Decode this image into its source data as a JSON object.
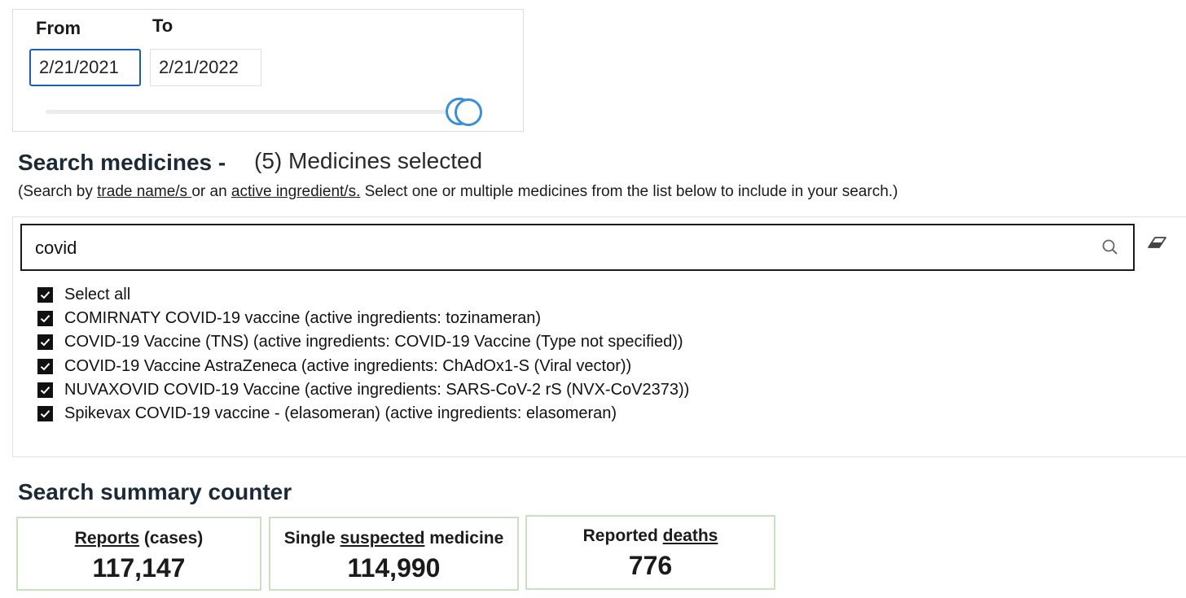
{
  "date_range": {
    "from_label": "From",
    "to_label": "To",
    "from_value": "2/21/2021",
    "to_value": "2/21/2022",
    "slider_position": 1.0
  },
  "search": {
    "title": "Search medicines -",
    "selected_count_text": "(5) Medicines selected",
    "help": {
      "prefix": "(Search by ",
      "trade_name_link": "trade name/s ",
      "middle": "or an ",
      "ingredient_link": "active ingredient/s.",
      "suffix": " Select one or multiple medicines from the list below to include in your search.)"
    },
    "query": "covid",
    "options": [
      {
        "label": "Select all",
        "checked": true
      },
      {
        "label": "COMIRNATY COVID-19 vaccine (active ingredients: tozinameran)",
        "checked": true
      },
      {
        "label": "COVID-19 Vaccine (TNS) (active ingredients: COVID-19 Vaccine (Type not specified))",
        "checked": true
      },
      {
        "label": "COVID-19 Vaccine AstraZeneca (active ingredients: ChAdOx1-S (Viral vector))",
        "checked": true
      },
      {
        "label": "NUVAXOVID COVID-19 Vaccine (active ingredients: SARS-CoV-2 rS (NVX-CoV2373))",
        "checked": true
      },
      {
        "label": "Spikevax COVID-19 vaccine - (elasomeran) (active ingredients: elasomeran)",
        "checked": true
      }
    ]
  },
  "summary": {
    "title": "Search summary counter",
    "reports": {
      "label_link": "Reports",
      "label_rest": " (cases)",
      "value": "117,147"
    },
    "single": {
      "label_pre": "Single ",
      "label_link": "suspected",
      "label_post": " medicine",
      "value": "114,990"
    },
    "deaths": {
      "label_pre": "Reported ",
      "label_link": "deaths",
      "value": "776"
    }
  },
  "colors": {
    "focus_border": "#1a5fb4",
    "slider_knob": "#3a8fd6",
    "card_border": "#c8e2c0",
    "heading": "#1b2a36"
  },
  "icons": {
    "search": "search-icon",
    "clear": "eraser-icon",
    "checkbox": "checkmark-icon"
  }
}
